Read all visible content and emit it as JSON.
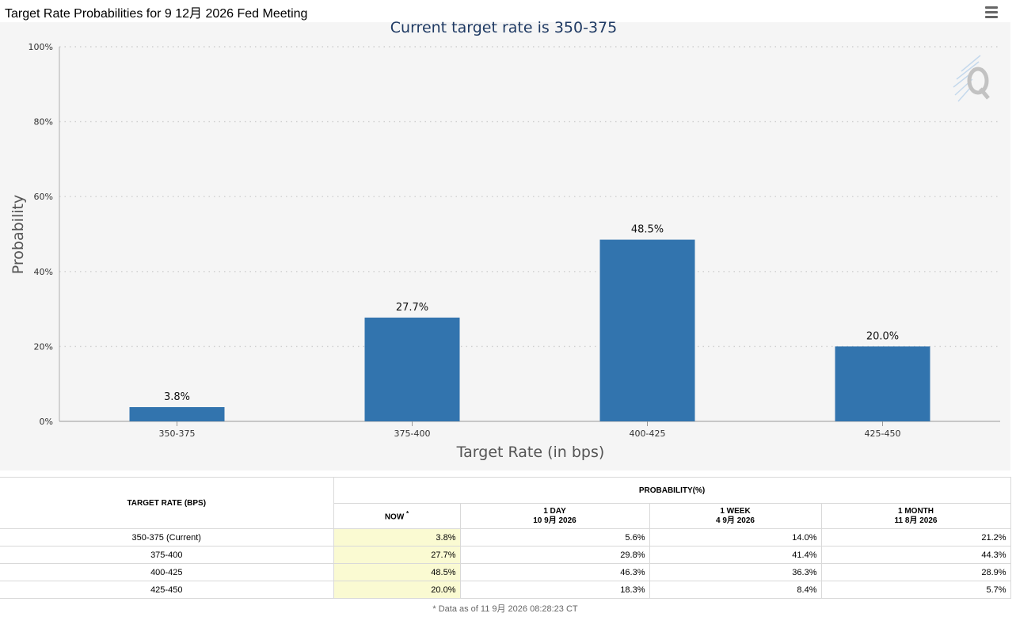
{
  "header": {
    "title": "Target Rate Probabilities for 9 12月 2026 Fed Meeting"
  },
  "chart_data": {
    "type": "bar",
    "title": "Current target rate is 350-375",
    "xlabel": "Target Rate (in bps)",
    "ylabel": "Probability",
    "categories": [
      "350-375",
      "375-400",
      "400-425",
      "425-450"
    ],
    "values": [
      3.8,
      27.7,
      48.5,
      20.0
    ],
    "data_labels": [
      "3.8%",
      "27.7%",
      "48.5%",
      "20.0%"
    ],
    "ylim": [
      0,
      100
    ],
    "yticks": [
      0,
      20,
      40,
      60,
      80,
      100
    ],
    "ytick_labels": [
      "0%",
      "20%",
      "40%",
      "60%",
      "80%",
      "100%"
    ],
    "grid": true,
    "bar_color": "#3274ae",
    "title_color": "#1f3a63"
  },
  "table": {
    "rate_header": "TARGET RATE (BPS)",
    "prob_header": "PROBABILITY(%)",
    "now_label": "NOW",
    "now_mark": "*",
    "columns": [
      {
        "label": "1 DAY",
        "date": "10 9月 2026"
      },
      {
        "label": "1 WEEK",
        "date": "4 9月 2026"
      },
      {
        "label": "1 MONTH",
        "date": "11 8月 2026"
      }
    ],
    "rows": [
      {
        "rate": "350-375 (Current)",
        "now": "3.8%",
        "day": "5.6%",
        "week": "14.0%",
        "month": "21.2%"
      },
      {
        "rate": "375-400",
        "now": "27.7%",
        "day": "29.8%",
        "week": "41.4%",
        "month": "44.3%"
      },
      {
        "rate": "400-425",
        "now": "48.5%",
        "day": "46.3%",
        "week": "36.3%",
        "month": "28.9%"
      },
      {
        "rate": "425-450",
        "now": "20.0%",
        "day": "18.3%",
        "week": "8.4%",
        "month": "5.7%"
      }
    ],
    "footnote": "* Data as of 11 9月 2026 08:28:23 CT"
  }
}
